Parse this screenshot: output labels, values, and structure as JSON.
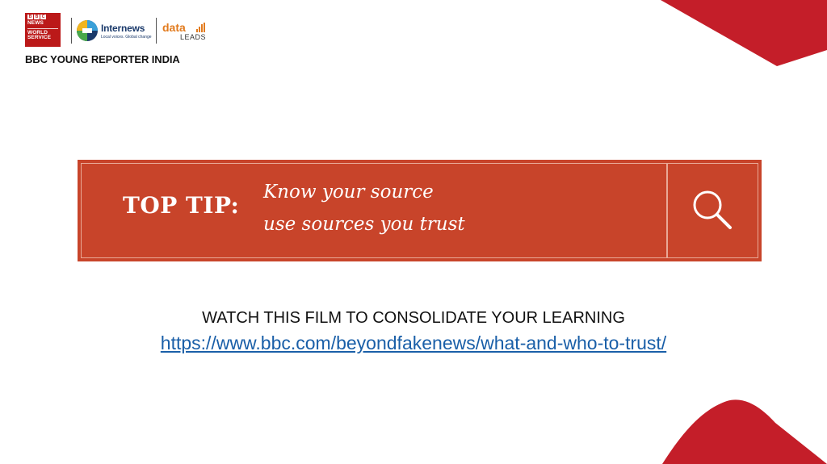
{
  "logos": {
    "bbc": {
      "blocks": [
        "B",
        "B",
        "C"
      ],
      "line1": "NEWS",
      "line2": "WORLD",
      "line3": "SERVICE"
    },
    "internews": {
      "name": "Internews",
      "tagline": "Local voices. Global change"
    },
    "dataleads": {
      "word1": "data",
      "word2": "LEADS"
    }
  },
  "brand_title": "BBC YOUNG REPORTER INDIA",
  "banner": {
    "label": "TOP TIP:",
    "line1": "Know your source",
    "line2": "use sources you trust",
    "icon": "search-icon"
  },
  "watch": {
    "text": "WATCH THIS FILM TO CONSOLIDATE YOUR LEARNING",
    "link": "https://www.bbc.com/beyondfakenews/what-and-who-to-trust/"
  },
  "colors": {
    "banner": "#c8442a",
    "accent_red": "#c41e29",
    "link": "#1a5fa8"
  }
}
